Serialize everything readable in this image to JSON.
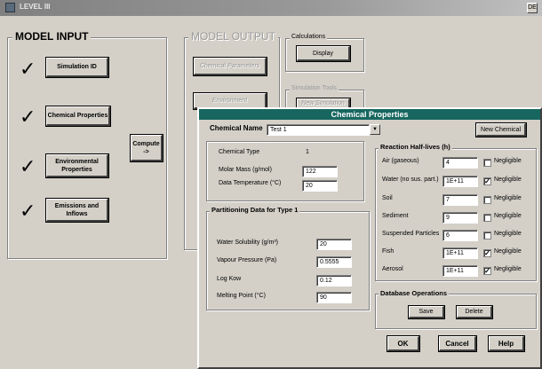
{
  "window": {
    "title": "LEVEL III",
    "corner_icon": "DE"
  },
  "model_input": {
    "label": "MODEL INPUT",
    "buttons": [
      {
        "label": "Simulation ID"
      },
      {
        "label": "Chemical Properties"
      },
      {
        "label": "Environmental Properties"
      },
      {
        "label": "Emissions and Inflows"
      }
    ],
    "checkmark": "✓"
  },
  "compute": {
    "label": "Compute",
    "arrow": "->"
  },
  "model_output": {
    "label": "MODEL OUTPUT",
    "chemical_parameters": "Chemical Parameters",
    "environment": "Environment"
  },
  "calculations": {
    "label": "Calculations",
    "display_button": "Display"
  },
  "simulation_tools": {
    "label": "Simulation Tools",
    "button": "New Simulation"
  },
  "dialog": {
    "title": "Chemical Properties",
    "chemical_name_label": "Chemical Name",
    "chemical_name_value": "Test 1",
    "new_chemical_button": "New Chemical",
    "chemical_type_label": "Chemical Type",
    "chemical_type_value": "1",
    "molar_mass_label": "Molar Mass (g/mol)",
    "molar_mass_value": "122",
    "data_temperature_label": "Data Temperature (°C)",
    "data_temperature_value": "20",
    "partitioning": {
      "label": "Partitioning Data for Type 1",
      "rows": [
        {
          "label": "Water Solubility (g/m³)",
          "value": "20"
        },
        {
          "label": "Vapour Pressure (Pa)",
          "value": "0.5555"
        },
        {
          "label": "Log Kow",
          "value": "0.12"
        },
        {
          "label": "Melting Point (°C)",
          "value": "90"
        }
      ]
    },
    "half_lives": {
      "label": "Reaction Half-lives (h)",
      "negligible_label": "Negligible",
      "rows": [
        {
          "label": "Air (gaseous)",
          "value": "4",
          "negligible": false
        },
        {
          "label": "Water (no sus. part.)",
          "value": "1E+11",
          "negligible": true
        },
        {
          "label": "Soil",
          "value": "7",
          "negligible": false
        },
        {
          "label": "Sediment",
          "value": "9",
          "negligible": false
        },
        {
          "label": "Suspended Particles",
          "value": "6",
          "negligible": false
        },
        {
          "label": "Fish",
          "value": "1E+11",
          "negligible": true
        },
        {
          "label": "Aerosol",
          "value": "1E+11",
          "negligible": true
        }
      ]
    },
    "database": {
      "label": "Database Operations",
      "save": "Save",
      "delete": "Delete"
    },
    "ok": "OK",
    "cancel": "Cancel",
    "help": "Help"
  }
}
